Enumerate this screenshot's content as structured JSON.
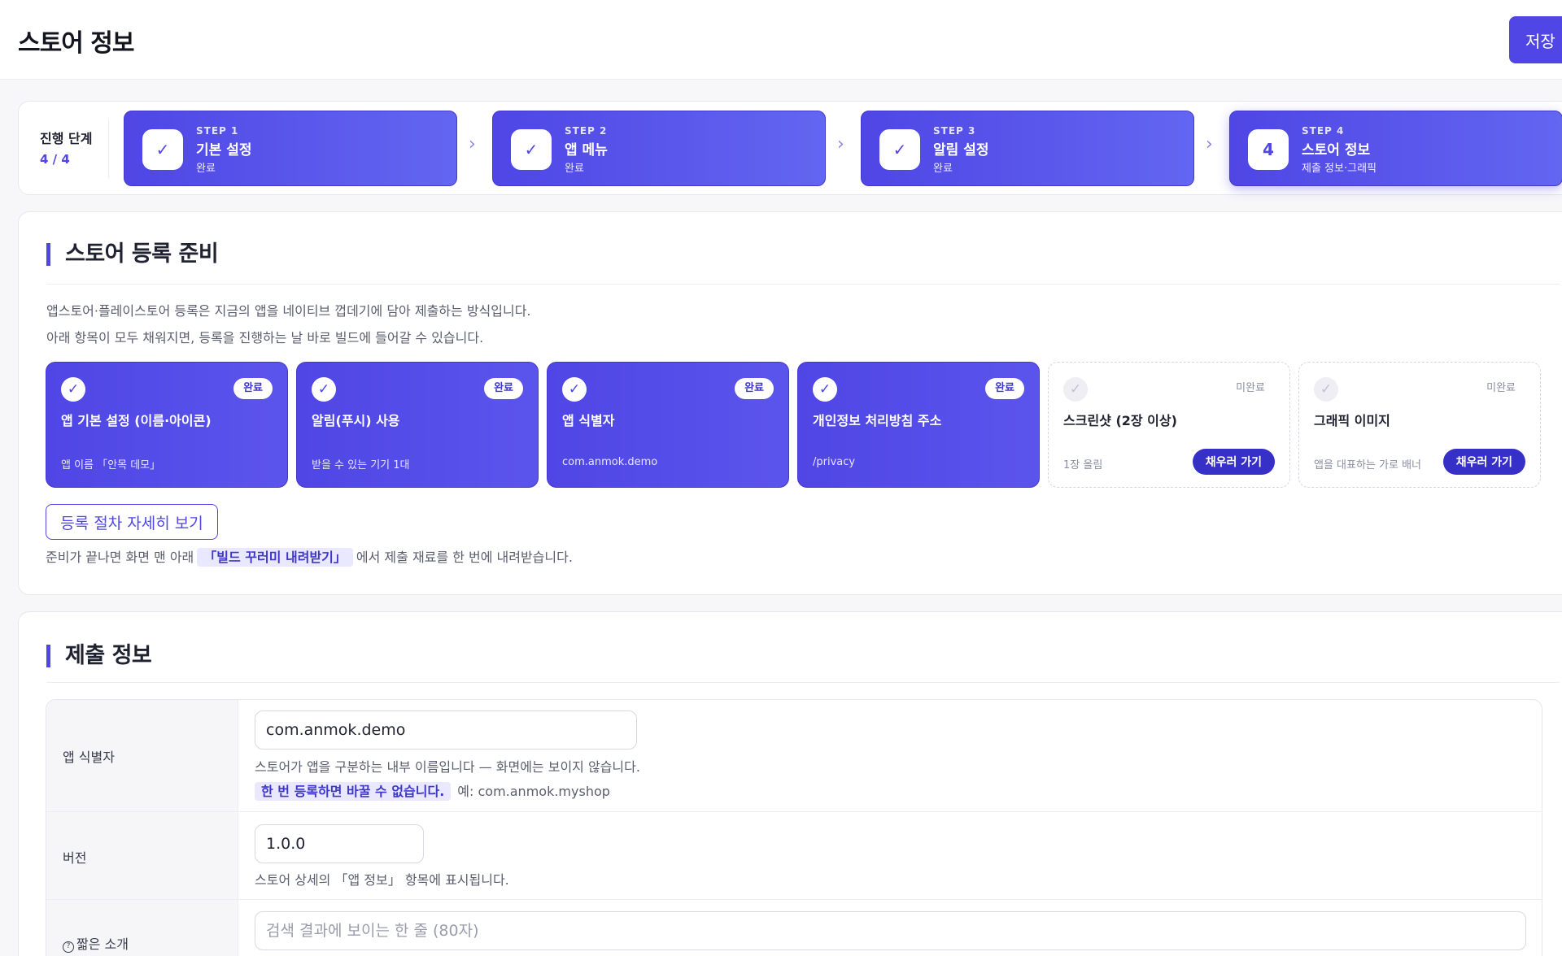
{
  "header": {
    "title": "스토어 정보",
    "save_label": "저장"
  },
  "stepper": {
    "progress_label": "진행 단계",
    "progress_count": "4 / 4",
    "steps": [
      {
        "kicker": "STEP 1",
        "title": "기본 설정",
        "sub": "완료",
        "badge": "✓"
      },
      {
        "kicker": "STEP 2",
        "title": "앱 메뉴",
        "sub": "완료",
        "badge": "✓"
      },
      {
        "kicker": "STEP 3",
        "title": "알림 설정",
        "sub": "완료",
        "badge": "✓"
      },
      {
        "kicker": "STEP 4",
        "title": "스토어 정보",
        "sub": "제출 정보·그래픽",
        "badge": "4"
      }
    ],
    "arrow": "›"
  },
  "prep": {
    "title": "스토어 등록 준비",
    "desc1": "앱스토어·플레이스토어 등록은 지금의 앱을 네이티브 껍데기에 담아 제출하는 방식입니다.",
    "desc2": "아래 항목이 모두 채워지면, 등록을 진행하는 날 바로 빌드에 들어갈 수 있습니다.",
    "items": [
      {
        "status": "완료",
        "title": "앱 기본 설정 (이름·아이콘)",
        "sub": "앱 이름 「안목 데모」"
      },
      {
        "status": "완료",
        "title": "알림(푸시) 사용",
        "sub": "받을 수 있는 기기 1대"
      },
      {
        "status": "완료",
        "title": "앱 식별자",
        "sub": "com.anmok.demo"
      },
      {
        "status": "완료",
        "title": "개인정보 처리방침 주소",
        "sub": "/privacy"
      },
      {
        "status": "미완료",
        "title": "스크린샷 (2장 이상)",
        "sub": "1장 올림",
        "action": "채우러 가기"
      },
      {
        "status": "미완료",
        "title": "그래픽 이미지",
        "sub": "앱을 대표하는 가로 배너",
        "action": "채우러 가기"
      }
    ],
    "check": "✓",
    "detail_button": "등록 절차 자세히 보기",
    "note_before": "준비가 끝나면 화면 맨 아래",
    "note_highlight": "「빌드 꾸러미 내려받기」",
    "note_after": "에서 제출 재료를 한 번에 내려받습니다."
  },
  "submit": {
    "title": "제출 정보",
    "fields": {
      "app_id": {
        "label": "앱 식별자",
        "value": "com.anmok.demo",
        "help": "스토어가 앱을 구분하는 내부 이름입니다 — 화면에는 보이지 않습니다.",
        "warn": "한 번 등록하면 바꿀 수 없습니다.",
        "example": "예: com.anmok.myshop"
      },
      "version": {
        "label": "버전",
        "value": "1.0.0",
        "help": "스토어 상세의 「앱 정보」 항목에 표시됩니다."
      },
      "short_desc": {
        "label": "짧은 소개",
        "info_icon": "?",
        "placeholder": "검색 결과에 보이는 한 줄 (80자)"
      }
    }
  },
  "colors": {
    "accent": "#4f46e5",
    "accent_dark": "#3730c8",
    "bg": "#f7f7f9"
  }
}
